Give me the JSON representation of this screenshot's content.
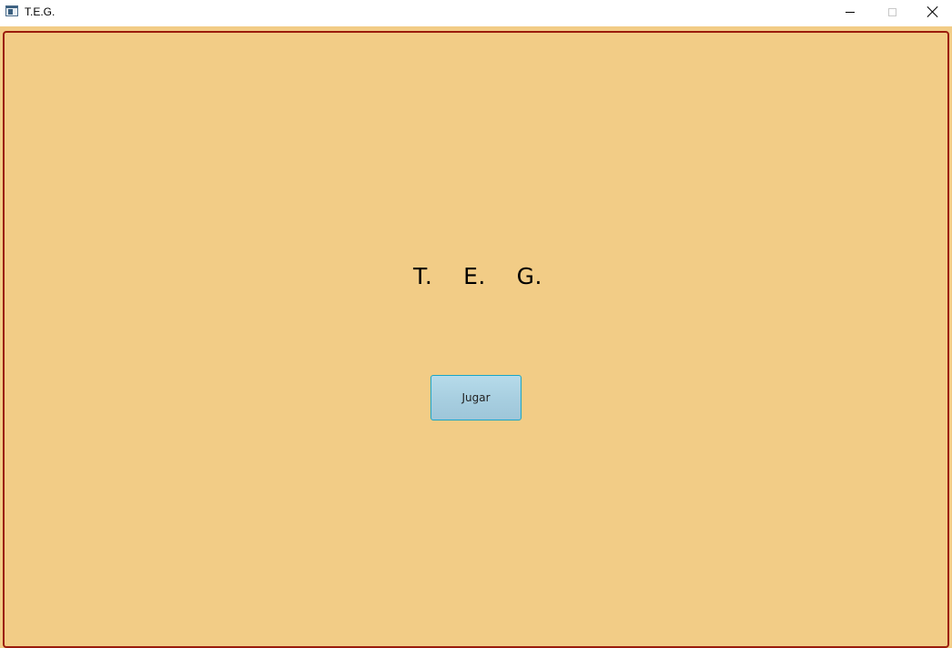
{
  "window": {
    "title": "T.E.G.",
    "icons": {
      "app": "window-app-icon",
      "minimize": "minimize-icon",
      "maximize": "maximize-icon",
      "close": "close-icon"
    }
  },
  "colors": {
    "background": "#f2cc86",
    "panel_border": "#9b1c0c",
    "button_border": "#1aa6c6",
    "button_fill": "#a7cee0"
  },
  "main": {
    "title": "T.    E.    G.",
    "play_button_label": "Jugar"
  }
}
